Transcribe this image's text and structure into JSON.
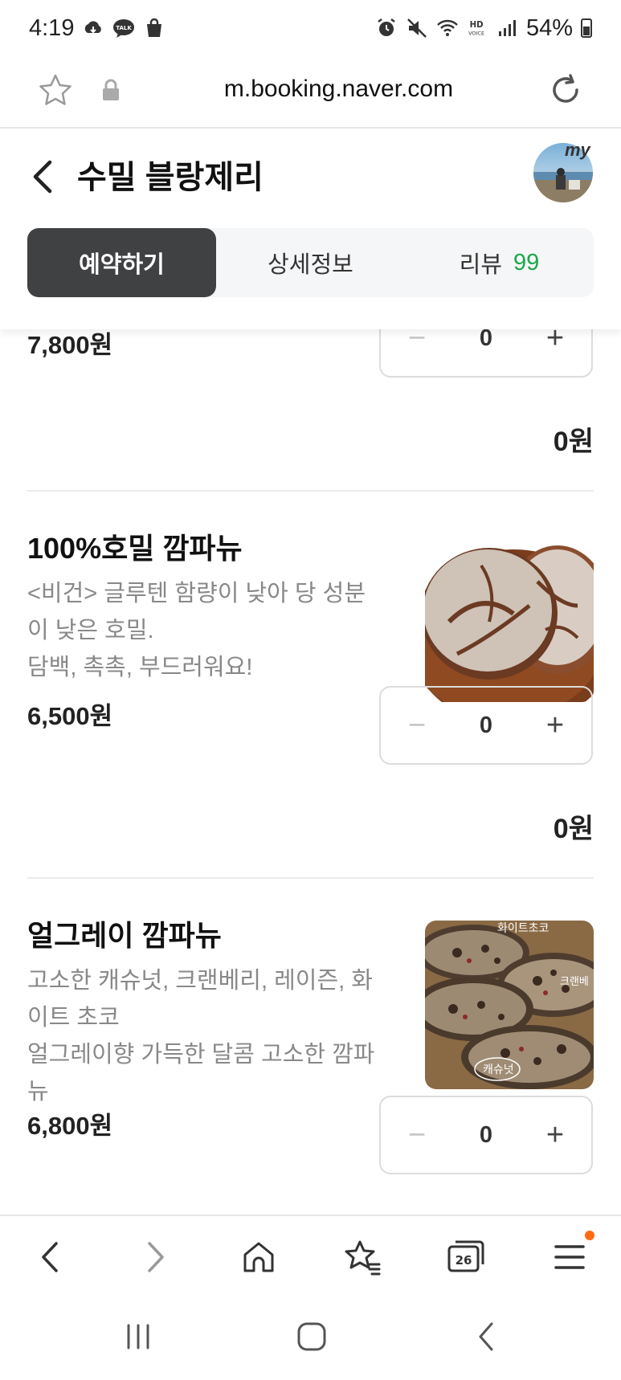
{
  "status_bar": {
    "time": "4:19",
    "battery": "54%",
    "icons_left": [
      "cloud-icon",
      "talk-icon",
      "shopping-bag-icon"
    ],
    "icons_right": [
      "alarm-icon",
      "mute-icon",
      "wifi-icon",
      "hd-voice-icon",
      "signal-icon",
      "battery-icon"
    ],
    "hd_voice_label": "HD VOICE"
  },
  "address_bar": {
    "url": "m.booking.naver.com"
  },
  "header": {
    "title": "수밀 블랑제리",
    "my_badge": "my"
  },
  "tabs": [
    {
      "label": "예약하기",
      "active": true
    },
    {
      "label": "상세정보",
      "active": false
    },
    {
      "label": "리뷰",
      "count": "99",
      "active": false
    }
  ],
  "items": [
    {
      "price": "7,800원",
      "quantity": "0",
      "subtotal": "0원"
    },
    {
      "name": "100%호밀 깜파뉴",
      "description_lines": [
        "<비건> 글루텐 함량이 낮아 당 성분이 낮은 호밀.",
        "담백, 촉촉, 부드러워요!"
      ],
      "price": "6,500원",
      "quantity": "0",
      "subtotal": "0원"
    },
    {
      "name": "얼그레이 깜파뉴",
      "description_lines": [
        "고소한 캐슈넛, 크랜베리, 레이즌, 화이트 초코",
        "얼그레이향 가득한 달콤 고소한 깜파뉴"
      ],
      "image_labels": [
        "화이트초코",
        "크랜베",
        "캐슈넛"
      ],
      "price": "6,800원",
      "quantity": "0"
    }
  ],
  "stepper": {
    "minus": "−",
    "plus": "+"
  },
  "browser_nav": {
    "tab_count": "26",
    "icons": [
      "back-icon",
      "forward-icon",
      "home-icon",
      "bookmarks-icon",
      "tabs-icon",
      "menu-icon"
    ]
  },
  "colors": {
    "active_tab_bg": "#404143",
    "review_count": "#1aa84a",
    "notification_dot": "#ff6a13"
  }
}
